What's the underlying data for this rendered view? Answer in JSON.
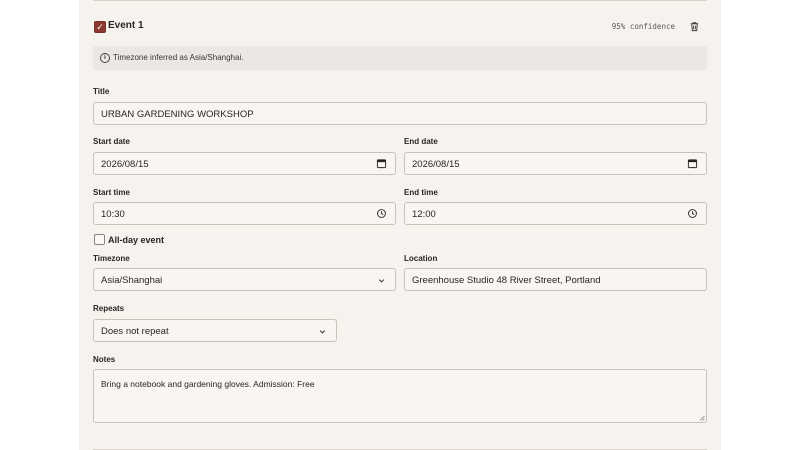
{
  "event": {
    "name": "Event 1",
    "selected": true,
    "confidence": "95% confidence"
  },
  "notice": {
    "text": "Timezone inferred as Asia/Shanghai."
  },
  "form": {
    "title": {
      "label": "Title",
      "value": "URBAN GARDENING WORKSHOP"
    },
    "start_date": {
      "label": "Start date",
      "value": "2026/08/15"
    },
    "end_date": {
      "label": "End date",
      "value": "2026/08/15"
    },
    "start_time": {
      "label": "Start time",
      "value": "10:30"
    },
    "end_time": {
      "label": "End time",
      "value": "12:00"
    },
    "all_day": {
      "label": "All-day event",
      "checked": false
    },
    "timezone": {
      "label": "Timezone",
      "value": "Asia/Shanghai"
    },
    "location": {
      "label": "Location",
      "value": "Greenhouse Studio 48 River Street, Portland"
    },
    "repeats": {
      "label": "Repeats",
      "value": "Does not repeat"
    },
    "notes": {
      "label": "Notes",
      "value": "Bring a notebook and gardening gloves. Admission: Free"
    }
  },
  "icons": {
    "trash": "trash-icon",
    "info": "info-icon",
    "calendar": "calendar-icon",
    "clock": "clock-icon",
    "chevron": "chevron-down-icon"
  },
  "colors": {
    "accent": "#8b3a32",
    "panel_bg": "#f6f2ee",
    "notice_bg": "#ece7e2"
  }
}
